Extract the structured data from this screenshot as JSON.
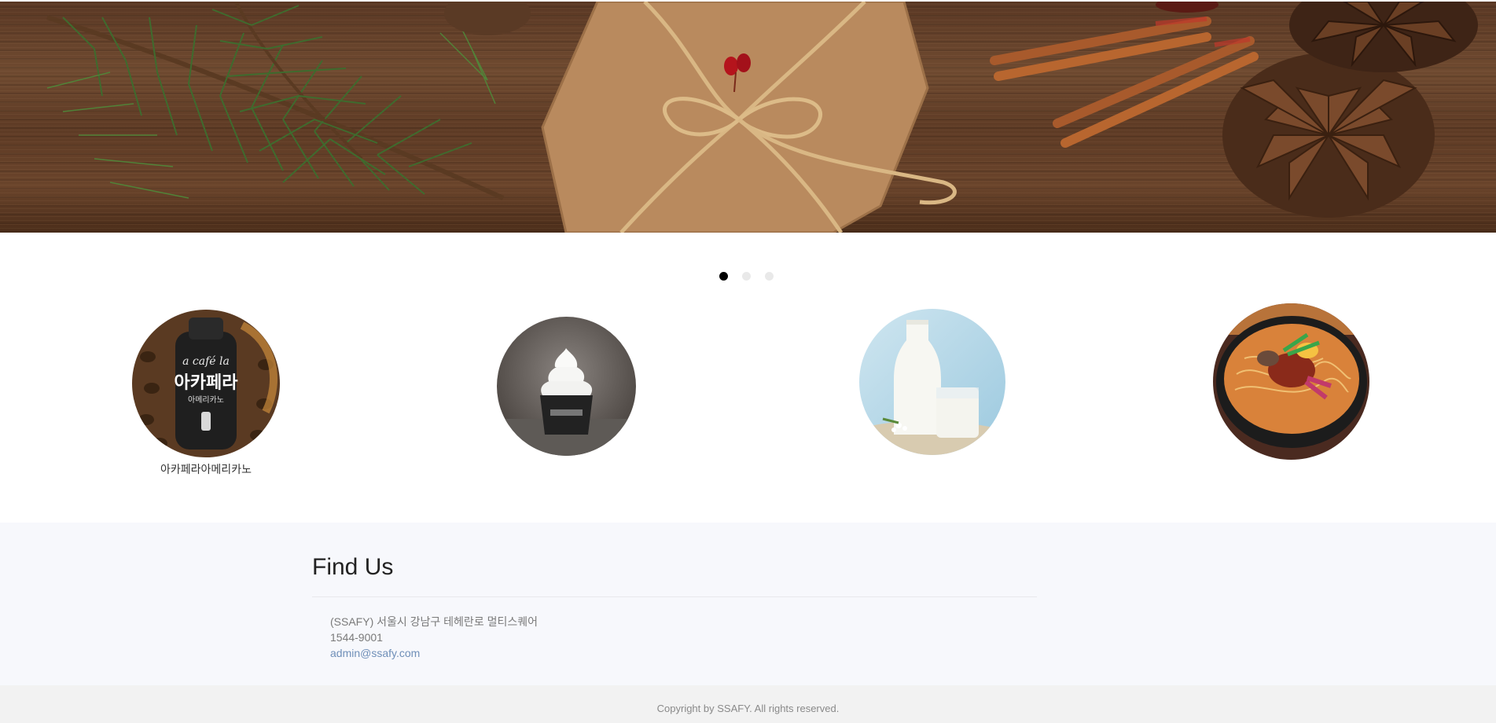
{
  "carousel": {
    "indicators": [
      {
        "active": true
      },
      {
        "active": false
      },
      {
        "active": false
      }
    ]
  },
  "products": [
    {
      "image": "acafela-americano-bottle",
      "label": "아카페라아메리카노"
    },
    {
      "image": "milk-soft-serve-ice-cream",
      "label": ""
    },
    {
      "image": "milk-bottle-and-glass",
      "label": ""
    },
    {
      "image": "ramen-bowl",
      "label": ""
    }
  ],
  "find_us": {
    "title": "Find Us",
    "address": "(SSAFY) 서울시 강남구 테헤란로 멀티스퀘어",
    "phone": "1544-9001",
    "email": "admin@ssafy.com"
  },
  "footer": {
    "copyright": "Copyright by SSAFY. All rights reserved."
  },
  "colors": {
    "findus_bg": "#f7f8fc",
    "footer_bg": "#f2f2f2",
    "link": "#6f8fb8",
    "indicator_active": "#000000",
    "indicator_inactive": "#e9e9e9"
  }
}
